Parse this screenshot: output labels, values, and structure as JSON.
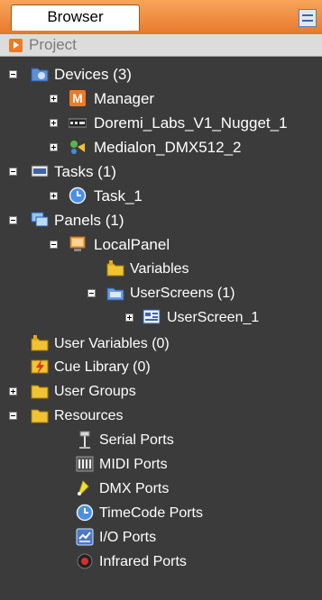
{
  "tab": {
    "label": "Browser"
  },
  "project": {
    "label": "Project"
  },
  "tree": {
    "devices": "Devices (3)",
    "manager": "Manager",
    "doremi": "Doremi_Labs_V1_Nugget_1",
    "medialon": "Medialon_DMX512_2",
    "tasks": "Tasks (1)",
    "task1": "Task_1",
    "panels": "Panels (1)",
    "localpanel": "LocalPanel",
    "variables": "Variables",
    "userscreens": "UserScreens (1)",
    "userscreen1": "UserScreen_1",
    "uservariables": "User Variables (0)",
    "cuelibrary": "Cue Library (0)",
    "usergroups": "User Groups",
    "resources": "Resources",
    "serial": "Serial Ports",
    "midi": "MIDI Ports",
    "dmx": "DMX Ports",
    "timecode": "TimeCode Ports",
    "io": "I/O Ports",
    "infrared": "Infrared Ports"
  },
  "colors": {
    "panel_bg": "#3b3b3b",
    "tab_accent": "#ee7a22",
    "folder": "#f1c232"
  }
}
